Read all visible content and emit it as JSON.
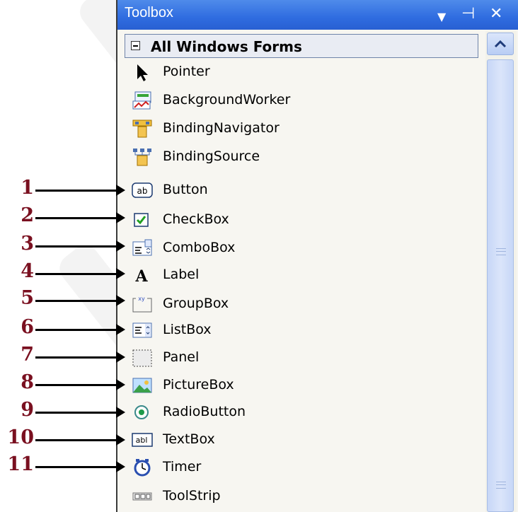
{
  "toolbox": {
    "title": "Toolbox",
    "group_label": "All Windows Forms",
    "items": [
      {
        "label": "Pointer",
        "icon": "pointer-icon"
      },
      {
        "label": "BackgroundWorker",
        "icon": "background-worker-icon"
      },
      {
        "label": "BindingNavigator",
        "icon": "binding-navigator-icon"
      },
      {
        "label": "BindingSource",
        "icon": "binding-source-icon"
      },
      {
        "label": "Button",
        "icon": "button-icon"
      },
      {
        "label": "CheckBox",
        "icon": "checkbox-icon"
      },
      {
        "label": "ComboBox",
        "icon": "combobox-icon"
      },
      {
        "label": "Label",
        "icon": "label-icon"
      },
      {
        "label": "GroupBox",
        "icon": "groupbox-icon"
      },
      {
        "label": "ListBox",
        "icon": "listbox-icon"
      },
      {
        "label": "Panel",
        "icon": "panel-icon"
      },
      {
        "label": "PictureBox",
        "icon": "picturebox-icon"
      },
      {
        "label": "RadioButton",
        "icon": "radiobutton-icon"
      },
      {
        "label": "TextBox",
        "icon": "textbox-icon"
      },
      {
        "label": "Timer",
        "icon": "timer-icon"
      },
      {
        "label": "ToolStrip",
        "icon": "toolstrip-icon"
      }
    ]
  },
  "callouts": [
    "1",
    "2",
    "3",
    "4",
    "5",
    "6",
    "7",
    "8",
    "9",
    "10",
    "11"
  ],
  "colors": {
    "titlebar": "#2f6ce0",
    "callout_number": "#7a1020",
    "panel_bg": "#f7f6f1"
  }
}
